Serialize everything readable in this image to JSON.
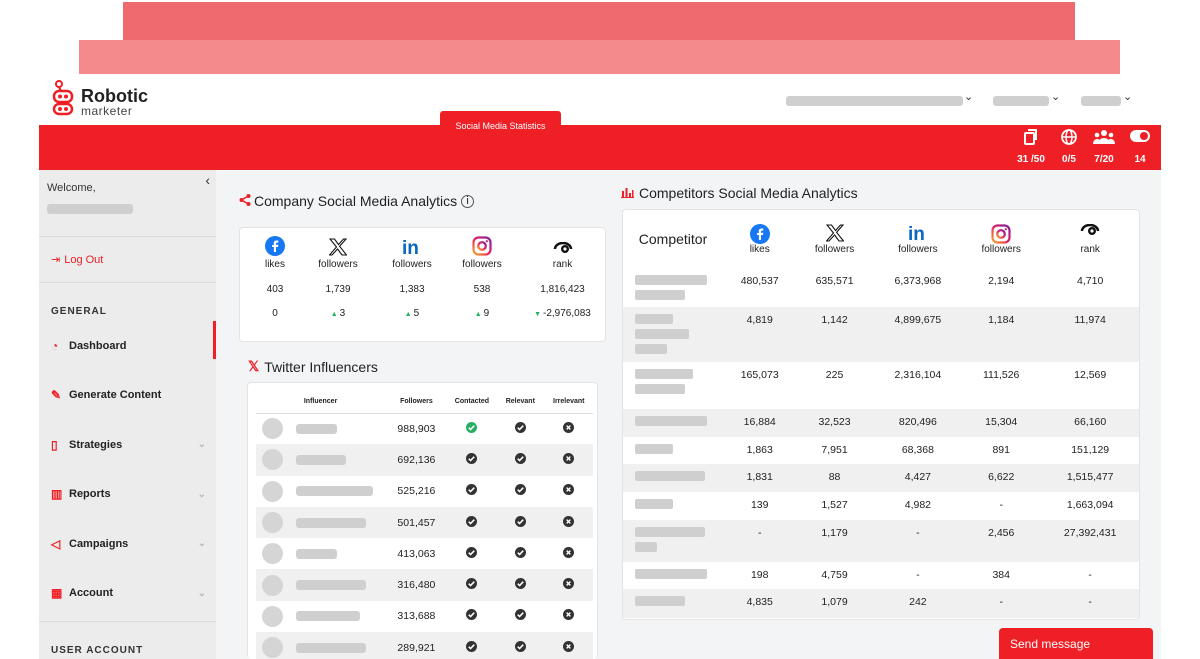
{
  "brand": {
    "name": "Robotic",
    "sub": "marketer",
    "color": "#ee2026"
  },
  "topbar_stats": [
    {
      "icon": "copy-icon",
      "value": "31 /50"
    },
    {
      "icon": "globe-icon",
      "value": "0/5"
    },
    {
      "icon": "users-icon",
      "value": "7/20"
    },
    {
      "icon": "toggle-icon",
      "value": "14"
    }
  ],
  "sidebar": {
    "welcome": "Welcome,",
    "logout": "Log Out",
    "section_general": "GENERAL",
    "items": [
      {
        "label": "Dashboard",
        "icon": "gauge-icon"
      },
      {
        "label": "Generate Content",
        "icon": "pencil-icon"
      },
      {
        "label": "Strategies",
        "icon": "file-icon"
      },
      {
        "label": "Reports",
        "icon": "map-icon"
      },
      {
        "label": "Campaigns",
        "icon": "send-icon"
      },
      {
        "label": "Account",
        "icon": "building-icon"
      }
    ],
    "section_user": "USER ACCOUNT"
  },
  "company": {
    "title": "Company Social Media Analytics",
    "button": "Social Media Statistics",
    "columns": [
      {
        "network": "facebook",
        "label": "likes",
        "value": "403",
        "change": "0",
        "dir": ""
      },
      {
        "network": "x",
        "label": "followers",
        "value": "1,739",
        "change": "3",
        "dir": "up"
      },
      {
        "network": "linkedin",
        "label": "followers",
        "value": "1,383",
        "change": "5",
        "dir": "up"
      },
      {
        "network": "instagram",
        "label": "followers",
        "value": "538",
        "change": "9",
        "dir": "up"
      },
      {
        "network": "semrush",
        "label": "rank",
        "value": "1,816,423",
        "change": "-2,976,083",
        "dir": "down"
      }
    ]
  },
  "twitter": {
    "title": "Twitter Influencers",
    "headers": [
      "Influencer",
      "Followers",
      "Contacted",
      "Relevant",
      "Irrelevant"
    ],
    "rows": [
      {
        "followers": "988,903",
        "contacted": true
      },
      {
        "followers": "692,136",
        "contacted": false
      },
      {
        "followers": "525,216",
        "contacted": false
      },
      {
        "followers": "501,457",
        "contacted": false
      },
      {
        "followers": "413,063",
        "contacted": false
      },
      {
        "followers": "316,480",
        "contacted": false
      },
      {
        "followers": "313,688",
        "contacted": false
      },
      {
        "followers": "289,921",
        "contacted": false
      }
    ]
  },
  "competitors": {
    "title": "Competitors Social Media Analytics",
    "first_header": "Competitor",
    "headers": [
      {
        "network": "facebook",
        "label": "likes"
      },
      {
        "network": "x",
        "label": "followers"
      },
      {
        "network": "linkedin",
        "label": "followers"
      },
      {
        "network": "instagram",
        "label": "followers"
      },
      {
        "network": "semrush",
        "label": "rank"
      }
    ],
    "rows": [
      [
        "480,537",
        "635,571",
        "6,373,968",
        "2,194",
        "4,710"
      ],
      [
        "4,819",
        "1,142",
        "4,899,675",
        "1,184",
        "11,974"
      ],
      [
        "165,073",
        "225",
        "2,316,104",
        "111,526",
        "12,569"
      ],
      [
        "16,884",
        "32,523",
        "820,496",
        "15,304",
        "66,160"
      ],
      [
        "1,863",
        "7,951",
        "68,368",
        "891",
        "151,129"
      ],
      [
        "1,831",
        "88",
        "4,427",
        "6,622",
        "1,515,477"
      ],
      [
        "139",
        "1,527",
        "4,982",
        "-",
        "1,663,094"
      ],
      [
        "-",
        "1,179",
        "-",
        "2,456",
        "27,392,431"
      ],
      [
        "198",
        "4,759",
        "-",
        "384",
        "-"
      ],
      [
        "4,835",
        "1,079",
        "242",
        "-",
        "-"
      ]
    ]
  },
  "send_message": "Send message"
}
